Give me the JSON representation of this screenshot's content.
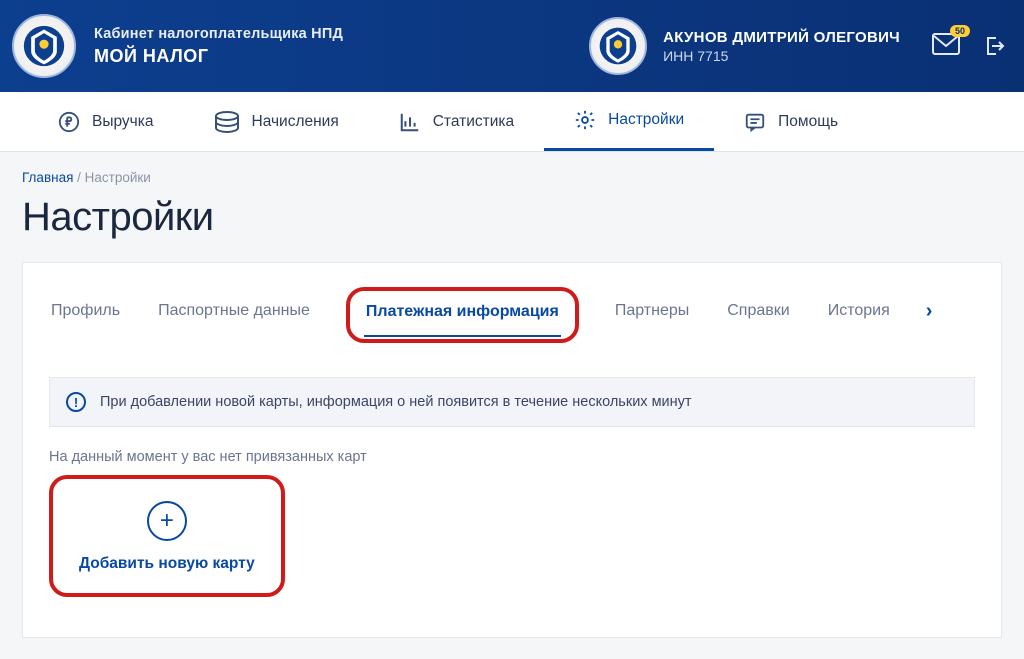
{
  "header": {
    "brand_top": "Кабинет налогоплательщика НПД",
    "brand_bottom": "МОЙ НАЛОГ",
    "user_name": "АКУНОВ ДМИТРИЙ ОЛЕГОВИЧ",
    "user_inn": "ИНН 7715",
    "mail_badge": "50"
  },
  "nav": {
    "items": [
      "Выручка",
      "Начисления",
      "Статистика",
      "Настройки",
      "Помощь"
    ],
    "active_index": 3
  },
  "breadcrumb": {
    "home": "Главная",
    "current": "Настройки"
  },
  "page_title": "Настройки",
  "tabs": {
    "items": [
      "Профиль",
      "Паспортные данные",
      "Платежная информация",
      "Партнеры",
      "Справки",
      "История"
    ],
    "active_index": 2
  },
  "info_banner": "При добавлении новой карты, информация о ней появится в течение нескольких минут",
  "empty_text": "На данный момент у вас нет привязанных карт",
  "add_card_label": "Добавить новую карту"
}
